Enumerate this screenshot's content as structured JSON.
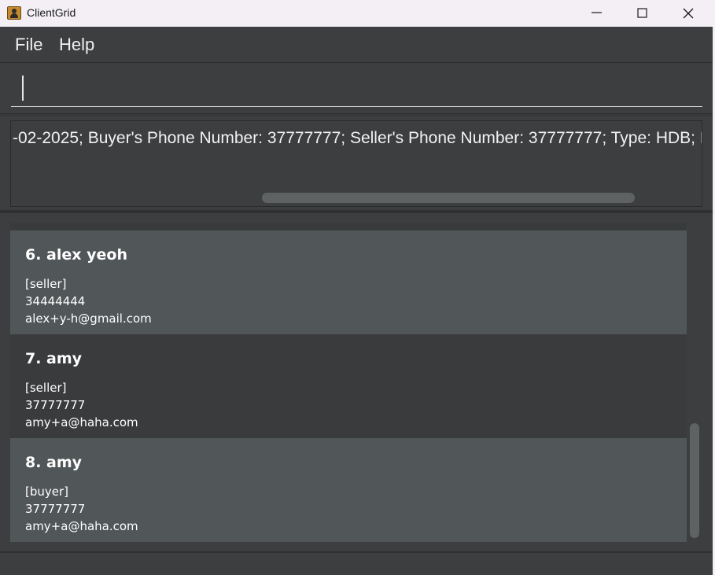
{
  "window": {
    "title": "ClientGrid",
    "icon": "contacts-app-icon",
    "controls": [
      "minimize-icon",
      "maximize-icon",
      "close-icon"
    ]
  },
  "menu": {
    "file_label": "File",
    "help_label": "Help"
  },
  "command": {
    "value": "",
    "placeholder": ""
  },
  "result": {
    "text": "-02-2025; Buyer's Phone Number: 37777777; Seller's Phone Number: 37777777; Type: HDB; Postal"
  },
  "clients": [
    {
      "index_name": "6. alex yeoh",
      "tag": "[seller]",
      "phone": "34444444",
      "email": "alex+y-h@gmail.com"
    },
    {
      "index_name": "7. amy",
      "tag": "[seller]",
      "phone": "37777777",
      "email": "amy+a@haha.com"
    },
    {
      "index_name": "8. amy",
      "tag": "[buyer]",
      "phone": "37777777",
      "email": "amy+a@haha.com"
    }
  ],
  "colors": {
    "background": "#3c3e3f",
    "card_light": "#515658",
    "card_dark": "#3a3b3c",
    "titlebar": "#f3eff5"
  }
}
